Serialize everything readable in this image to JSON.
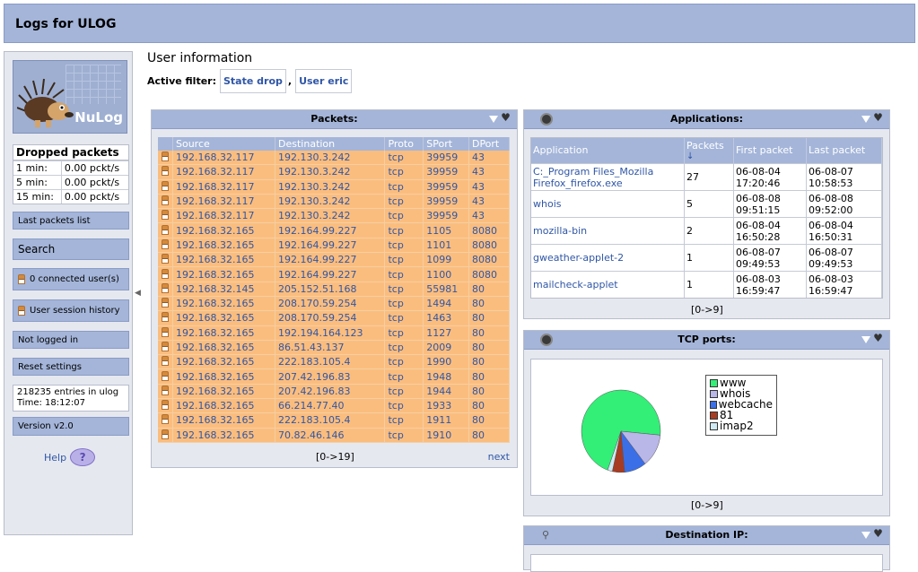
{
  "header": {
    "title": "Logs for ULOG"
  },
  "sidebar": {
    "logo_text": "NuLog",
    "dropped": {
      "title": "Dropped packets",
      "rows": [
        {
          "label": "1 min:",
          "value": "0.00 pckt/s"
        },
        {
          "label": "5 min:",
          "value": "0.00 pckt/s"
        },
        {
          "label": "15 min:",
          "value": "0.00 pckt/s"
        }
      ]
    },
    "last_packets": "Last packets list",
    "search": "Search",
    "connected": "0 connected user(s)",
    "session_history": "User session history",
    "not_logged": "Not logged in",
    "reset": "Reset settings",
    "entries": "218235 entries in ulog",
    "time": "Time: 18:12:07",
    "version": "Version v2.0",
    "help": "Help",
    "help_icon": "?"
  },
  "main": {
    "user_info": "User information",
    "filter_label": "Active filter:",
    "filter_state": "State drop",
    "filter_user": "User eric",
    "comma": ","
  },
  "packets": {
    "title": "Packets:",
    "columns": [
      "Source",
      "Destination",
      "Proto",
      "SPort",
      "DPort"
    ],
    "rows": [
      [
        "192.168.32.117",
        "192.130.3.242",
        "tcp",
        "39959",
        "43"
      ],
      [
        "192.168.32.117",
        "192.130.3.242",
        "tcp",
        "39959",
        "43"
      ],
      [
        "192.168.32.117",
        "192.130.3.242",
        "tcp",
        "39959",
        "43"
      ],
      [
        "192.168.32.117",
        "192.130.3.242",
        "tcp",
        "39959",
        "43"
      ],
      [
        "192.168.32.117",
        "192.130.3.242",
        "tcp",
        "39959",
        "43"
      ],
      [
        "192.168.32.165",
        "192.164.99.227",
        "tcp",
        "1105",
        "8080"
      ],
      [
        "192.168.32.165",
        "192.164.99.227",
        "tcp",
        "1101",
        "8080"
      ],
      [
        "192.168.32.165",
        "192.164.99.227",
        "tcp",
        "1099",
        "8080"
      ],
      [
        "192.168.32.165",
        "192.164.99.227",
        "tcp",
        "1100",
        "8080"
      ],
      [
        "192.168.32.145",
        "205.152.51.168",
        "tcp",
        "55981",
        "80"
      ],
      [
        "192.168.32.165",
        "208.170.59.254",
        "tcp",
        "1494",
        "80"
      ],
      [
        "192.168.32.165",
        "208.170.59.254",
        "tcp",
        "1463",
        "80"
      ],
      [
        "192.168.32.165",
        "192.194.164.123",
        "tcp",
        "1127",
        "80"
      ],
      [
        "192.168.32.165",
        "86.51.43.137",
        "tcp",
        "2009",
        "80"
      ],
      [
        "192.168.32.165",
        "222.183.105.4",
        "tcp",
        "1990",
        "80"
      ],
      [
        "192.168.32.165",
        "207.42.196.83",
        "tcp",
        "1948",
        "80"
      ],
      [
        "192.168.32.165",
        "207.42.196.83",
        "tcp",
        "1944",
        "80"
      ],
      [
        "192.168.32.165",
        "66.214.77.40",
        "tcp",
        "1933",
        "80"
      ],
      [
        "192.168.32.165",
        "222.183.105.4",
        "tcp",
        "1911",
        "80"
      ],
      [
        "192.168.32.165",
        "70.82.46.146",
        "tcp",
        "1910",
        "80"
      ]
    ],
    "range": "[0->19]",
    "next": "next"
  },
  "applications": {
    "title": "Applications:",
    "columns": [
      "Application",
      "Packets",
      "First packet",
      "Last packet"
    ],
    "sort_icon": "↓",
    "rows": [
      {
        "app": "C:_Program Files_Mozilla Firefox_firefox.exe",
        "packets": "27",
        "first": "06-08-04 17:20:46",
        "last": "06-08-07 10:58:53"
      },
      {
        "app": "whois",
        "packets": "5",
        "first": "06-08-08 09:51:15",
        "last": "06-08-08 09:52:00"
      },
      {
        "app": "mozilla-bin",
        "packets": "2",
        "first": "06-08-04 16:50:28",
        "last": "06-08-04 16:50:31"
      },
      {
        "app": "gweather-applet-2",
        "packets": "1",
        "first": "06-08-07 09:49:53",
        "last": "06-08-07 09:49:53"
      },
      {
        "app": "mailcheck-applet",
        "packets": "1",
        "first": "06-08-03 16:59:47",
        "last": "06-08-03 16:59:47"
      }
    ],
    "range": "[0->9]"
  },
  "tcp_ports": {
    "title": "TCP ports:",
    "range": "[0->9]",
    "colors": {
      "www": "#33ee77",
      "whois": "#b9b6e8",
      "webcache": "#3b6fe8",
      "81": "#a83c22",
      "imap2": "#cfeaf4"
    }
  },
  "destination_ip": {
    "title": "Destination IP:"
  },
  "chart_data": {
    "type": "pie",
    "title": "",
    "labels": [
      "www",
      "whois",
      "webcache",
      "81",
      "imap2"
    ],
    "values": [
      71,
      13,
      9,
      5,
      2
    ],
    "colors": [
      "#33ee77",
      "#b9b6e8",
      "#3b6fe8",
      "#a83c22",
      "#cfeaf4"
    ],
    "legend": "right"
  }
}
